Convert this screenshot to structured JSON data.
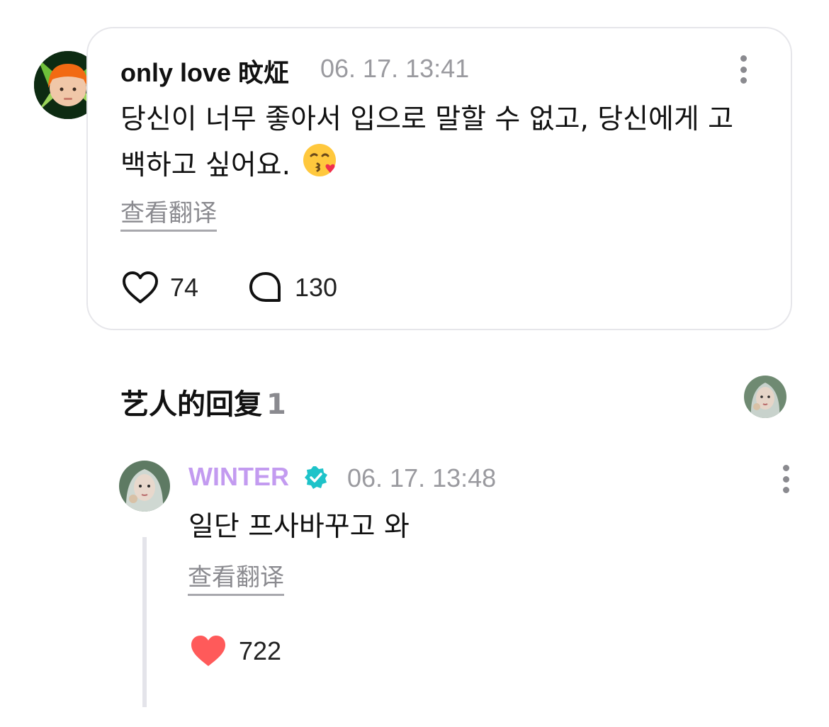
{
  "post": {
    "author": "only love 旼炡",
    "time": "06. 17. 13:41",
    "text": "당신이 너무 좋아서 입으로 말할 수 없고, 당신에게 고백하고 싶어요.",
    "emoji": "face-blowing-a-kiss",
    "translate_label": "查看翻译",
    "like_count": "74",
    "reply_count": "130"
  },
  "artist_replies": {
    "title": "艺人的回复",
    "count": "1"
  },
  "reply": {
    "author": "WINTER",
    "time": "06. 17. 13:48",
    "text": "일단 프사바꾸고 와",
    "translate_label": "查看翻译",
    "like_count": "722"
  },
  "colors": {
    "artist_name": "#c39bf0",
    "verified_badge": "#1ec3c9",
    "liked_heart": "#ff5a5a",
    "muted_text": "#9a9a9f"
  }
}
